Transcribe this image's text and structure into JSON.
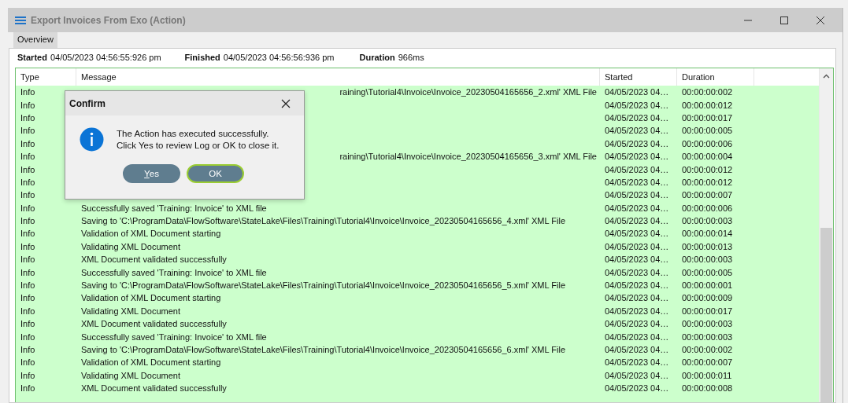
{
  "window": {
    "title": "Export Invoices From Exo (Action)"
  },
  "tabs": [
    {
      "label": "Overview",
      "selected": true
    }
  ],
  "summary": [
    {
      "label": "Started",
      "value": "04/05/2023 04:56:55:926 pm"
    },
    {
      "label": "Finished",
      "value": "04/05/2023 04:56:56:936 pm"
    },
    {
      "label": "Duration",
      "value": "966ms"
    }
  ],
  "table": {
    "columns": [
      "Type",
      "Message",
      "Started",
      "Duration"
    ],
    "rows": [
      {
        "type": "Info",
        "message": "raining\\Tutorial4\\Invoice\\Invoice_20230504165656_2.xml' XML File",
        "clipped": true,
        "started": "04/05/2023 04…",
        "duration": "00:00:00:002"
      },
      {
        "type": "Info",
        "started": "04/05/2023 04…",
        "duration": "00:00:00:012"
      },
      {
        "type": "Info",
        "started": "04/05/2023 04…",
        "duration": "00:00:00:017"
      },
      {
        "type": "Info",
        "started": "04/05/2023 04…",
        "duration": "00:00:00:005"
      },
      {
        "type": "Info",
        "started": "04/05/2023 04…",
        "duration": "00:00:00:006"
      },
      {
        "type": "Info",
        "message": "raining\\Tutorial4\\Invoice\\Invoice_20230504165656_3.xml' XML File",
        "clipped": true,
        "started": "04/05/2023 04…",
        "duration": "00:00:00:004"
      },
      {
        "type": "Info",
        "started": "04/05/2023 04…",
        "duration": "00:00:00:012"
      },
      {
        "type": "Info",
        "started": "04/05/2023 04…",
        "duration": "00:00:00:012"
      },
      {
        "type": "Info",
        "started": "04/05/2023 04…",
        "duration": "00:00:00:007"
      },
      {
        "type": "Info",
        "message": "Successfully saved 'Training: Invoice' to XML file",
        "started": "04/05/2023 04…",
        "duration": "00:00:00:006"
      },
      {
        "type": "Info",
        "message": "Saving to 'C:\\ProgramData\\FlowSoftware\\StateLake\\Files\\Training\\Tutorial4\\Invoice\\Invoice_20230504165656_4.xml' XML File",
        "started": "04/05/2023 04…",
        "duration": "00:00:00:003"
      },
      {
        "type": "Info",
        "message": "Validation of XML Document starting",
        "started": "04/05/2023 04…",
        "duration": "00:00:00:014"
      },
      {
        "type": "Info",
        "message": "Validating XML Document",
        "started": "04/05/2023 04…",
        "duration": "00:00:00:013"
      },
      {
        "type": "Info",
        "message": "XML Document validated successfully",
        "started": "04/05/2023 04…",
        "duration": "00:00:00:003"
      },
      {
        "type": "Info",
        "message": "Successfully saved 'Training: Invoice' to XML file",
        "started": "04/05/2023 04…",
        "duration": "00:00:00:005"
      },
      {
        "type": "Info",
        "message": "Saving to 'C:\\ProgramData\\FlowSoftware\\StateLake\\Files\\Training\\Tutorial4\\Invoice\\Invoice_20230504165656_5.xml' XML File",
        "started": "04/05/2023 04…",
        "duration": "00:00:00:001"
      },
      {
        "type": "Info",
        "message": "Validation of XML Document starting",
        "started": "04/05/2023 04…",
        "duration": "00:00:00:009"
      },
      {
        "type": "Info",
        "message": "Validating XML Document",
        "started": "04/05/2023 04…",
        "duration": "00:00:00:017"
      },
      {
        "type": "Info",
        "message": "XML Document validated successfully",
        "started": "04/05/2023 04…",
        "duration": "00:00:00:003"
      },
      {
        "type": "Info",
        "message": "Successfully saved 'Training: Invoice' to XML file",
        "started": "04/05/2023 04…",
        "duration": "00:00:00:003"
      },
      {
        "type": "Info",
        "message": "Saving to 'C:\\ProgramData\\FlowSoftware\\StateLake\\Files\\Training\\Tutorial4\\Invoice\\Invoice_20230504165656_6.xml' XML File",
        "started": "04/05/2023 04…",
        "duration": "00:00:00:002"
      },
      {
        "type": "Info",
        "message": "Validation of XML Document starting",
        "started": "04/05/2023 04…",
        "duration": "00:00:00:007"
      },
      {
        "type": "Info",
        "message": "Validating XML Document",
        "started": "04/05/2023 04…",
        "duration": "00:00:00:011"
      },
      {
        "type": "Info",
        "message": "XML Document validated successfully",
        "started": "04/05/2023 04…",
        "duration": "00:00:00:008"
      }
    ]
  },
  "dialog": {
    "title": "Confirm",
    "message": "The Action has executed successfully.\nClick Yes to review Log or OK to close it.",
    "buttons": [
      {
        "label": "Yes",
        "mnemonic": true,
        "default": false
      },
      {
        "label": "OK",
        "mnemonic": false,
        "default": true
      }
    ]
  }
}
